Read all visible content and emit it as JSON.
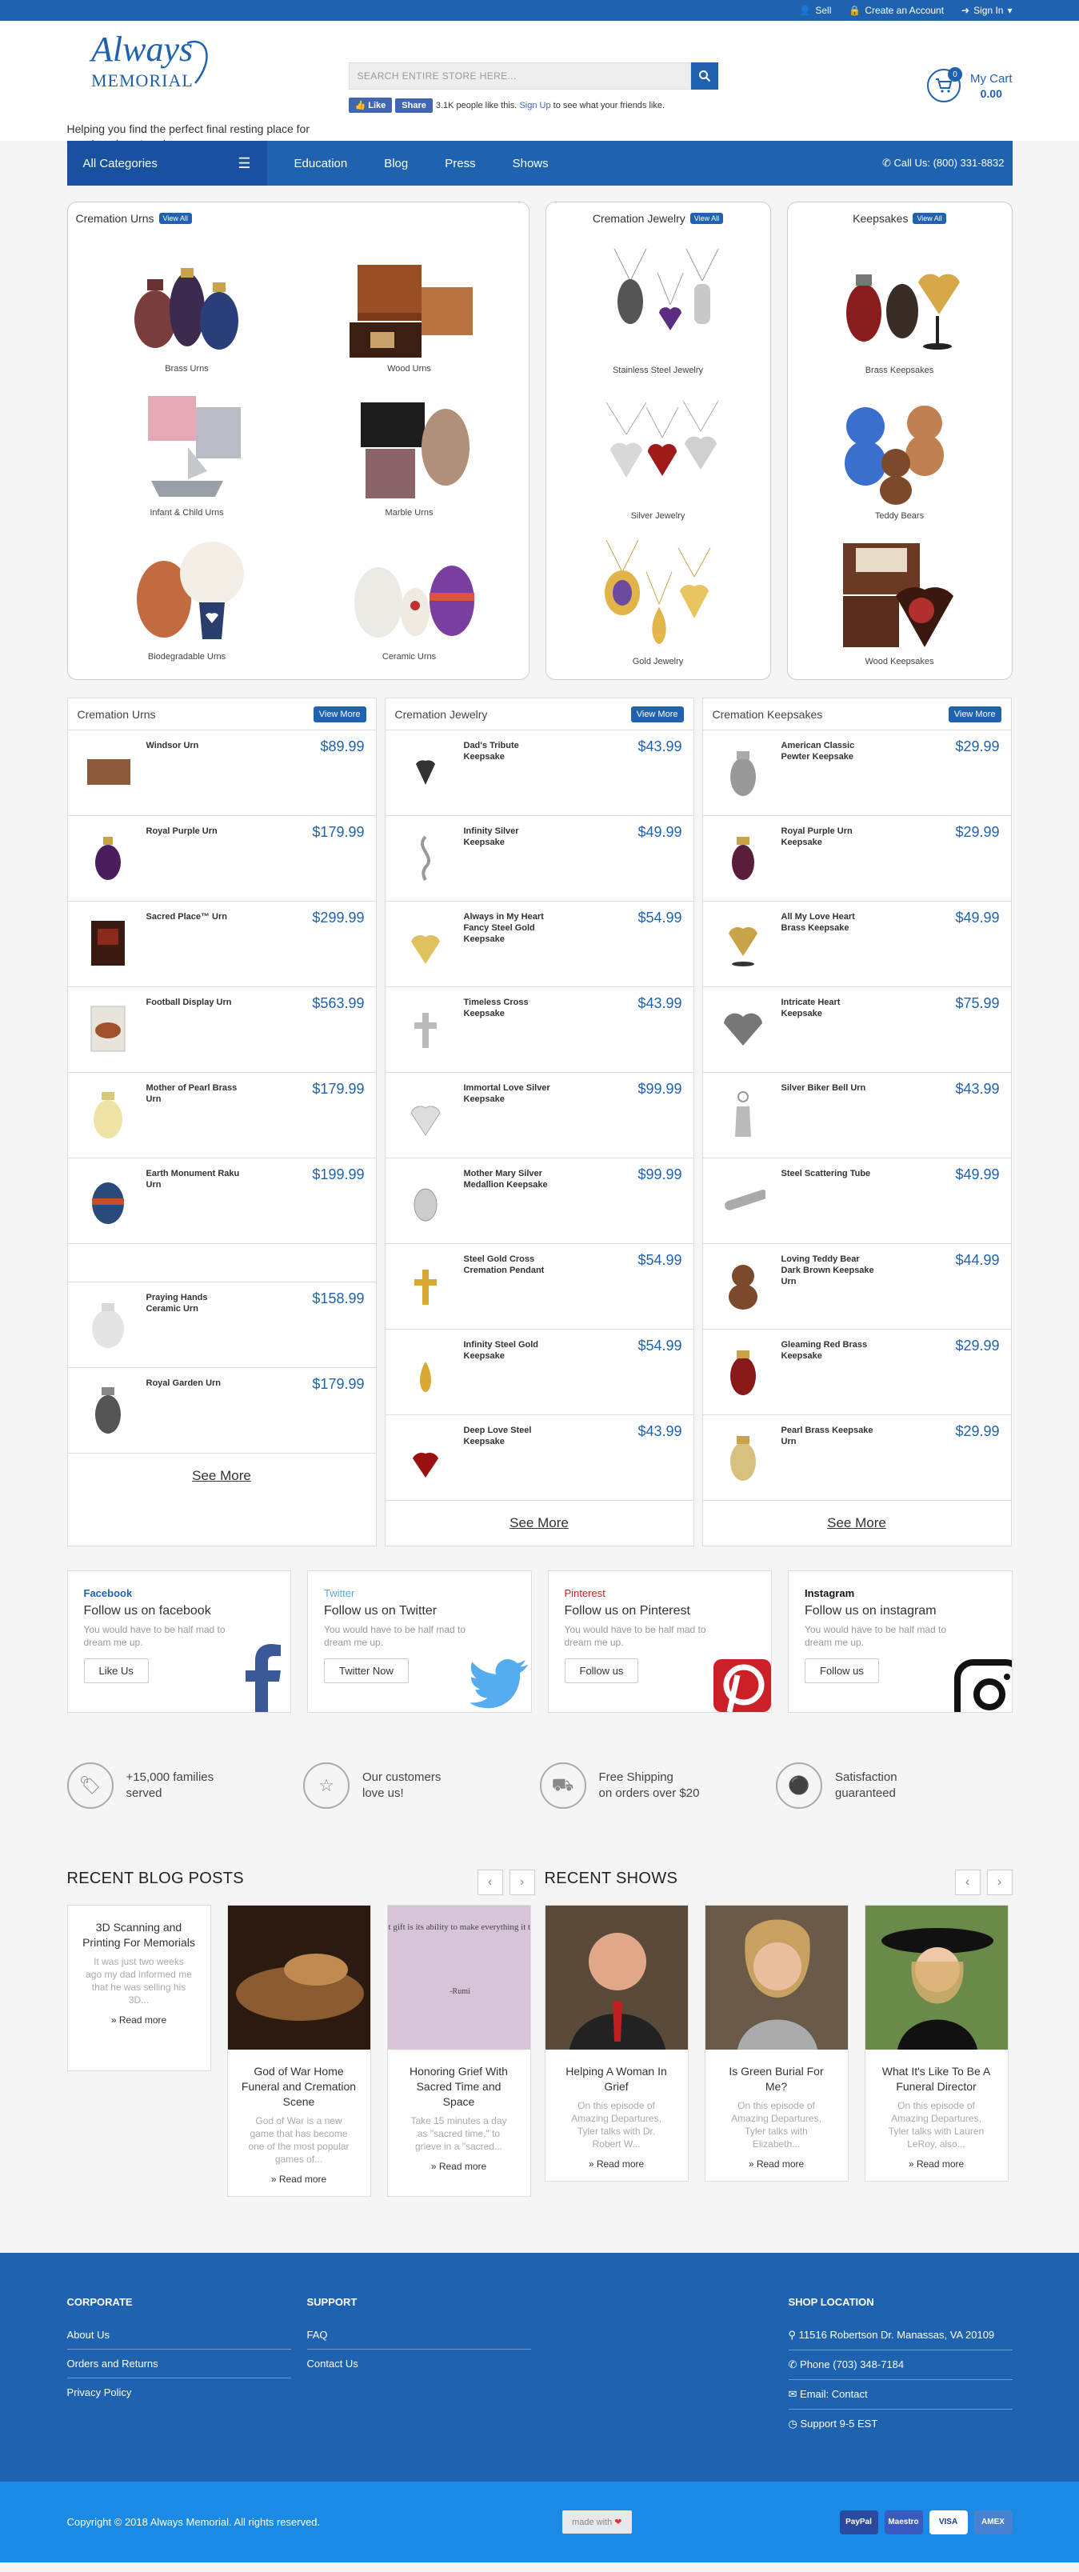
{
  "topbar": {
    "sell": "Sell",
    "create_account": "Create an Account",
    "sign_in": "Sign In"
  },
  "header": {
    "logo_line1": "Always",
    "logo_line2": "MEMORIAL",
    "tagline": "Helping you find the perfect final resting place for your loved one's ashes.",
    "search_placeholder": "SEARCH ENTIRE STORE HERE...",
    "fb_like": "Like",
    "fb_share": "Share",
    "fb_count_text": "3.1K people like this.",
    "fb_signup": "Sign Up",
    "fb_tail": "to see what your friends like.",
    "cart_label": "My Cart",
    "cart_total": "0.00",
    "cart_count": "0"
  },
  "nav": {
    "all_categories": "All Categories",
    "links": [
      "Education",
      "Blog",
      "Press",
      "Shows"
    ],
    "phone": "Call Us: (800) 331-8832"
  },
  "category_boxes": [
    {
      "title": "Cremation Urns",
      "view_all": "View All",
      "items": [
        "Brass Urns",
        "Wood Urns",
        "Infant & Child Urns",
        "Marble Urns",
        "Biodegradable Urns",
        "Ceramic Urns"
      ]
    },
    {
      "title": "Cremation Jewelry",
      "view_all": "View All",
      "items": [
        "Stainless Steel Jewelry",
        "Silver Jewelry",
        "Gold Jewelry"
      ]
    },
    {
      "title": "Keepsakes",
      "view_all": "View All",
      "items": [
        "Brass Keepsakes",
        "Teddy Bears",
        "Wood Keepsakes"
      ]
    }
  ],
  "product_columns": [
    {
      "title": "Cremation Urns",
      "view_more": "View More",
      "see_more": "See More",
      "products": [
        {
          "name": "Windsor Urn",
          "price": "$89.99"
        },
        {
          "name": "Royal Purple Urn",
          "price": "$179.99"
        },
        {
          "name": "Sacred Place™ Urn",
          "price": "$299.99"
        },
        {
          "name": "Football Display Urn",
          "price": "$563.99"
        },
        {
          "name": "Mother of Pearl Brass Urn",
          "price": "$179.99"
        },
        {
          "name": "Earth Monument Raku Urn",
          "price": "$199.99"
        },
        {
          "name": "Praying Hands Ceramic Urn",
          "price": "$158.99"
        },
        {
          "name": "Royal Garden Urn",
          "price": "$179.99"
        }
      ]
    },
    {
      "title": "Cremation Jewelry",
      "view_more": "View More",
      "see_more": "See More",
      "products": [
        {
          "name": "Dad's Tribute Keepsake",
          "price": "$43.99"
        },
        {
          "name": "Infinity Silver Keepsake",
          "price": "$49.99"
        },
        {
          "name": "Always in My Heart Fancy Steel Gold Keepsake",
          "price": "$54.99"
        },
        {
          "name": "Timeless Cross Keepsake",
          "price": "$43.99"
        },
        {
          "name": "Immortal Love Silver Keepsake",
          "price": "$99.99"
        },
        {
          "name": "Mother Mary Silver Medallion Keepsake",
          "price": "$99.99"
        },
        {
          "name": "Steel Gold Cross Cremation Pendant",
          "price": "$54.99"
        },
        {
          "name": "Infinity Steel Gold Keepsake",
          "price": "$54.99"
        },
        {
          "name": "Deep Love Steel Keepsake",
          "price": "$43.99"
        }
      ]
    },
    {
      "title": "Cremation Keepsakes",
      "view_more": "View More",
      "see_more": "See More",
      "products": [
        {
          "name": "American Classic Pewter Keepsake",
          "price": "$29.99"
        },
        {
          "name": "Royal Purple Urn Keepsake",
          "price": "$29.99"
        },
        {
          "name": "All My Love Heart Brass Keepsake",
          "price": "$49.99"
        },
        {
          "name": "Intricate Heart Keepsake",
          "price": "$75.99"
        },
        {
          "name": "Silver Biker Bell Urn",
          "price": "$43.99"
        },
        {
          "name": "Steel Scattering Tube",
          "price": "$49.99"
        },
        {
          "name": "Loving Teddy Bear Dark Brown Keepsake Urn",
          "price": "$44.99"
        },
        {
          "name": "Gleaming Red Brass Keepsake",
          "price": "$29.99"
        },
        {
          "name": "Pearl Brass Keepsake Urn",
          "price": "$29.99"
        }
      ]
    }
  ],
  "social": [
    {
      "name": "Facebook",
      "title": "Follow us on facebook",
      "desc": "You would have to be half mad to dream me up.",
      "button": "Like Us",
      "color": "#3b5998"
    },
    {
      "name": "Twitter",
      "title": "Follow us on Twitter",
      "desc": "You would have to be half mad to dream me up.",
      "button": "Twitter Now",
      "color": "#55acee"
    },
    {
      "name": "Pinterest",
      "title": "Follow us on Pinterest",
      "desc": "You would have to be half mad to dream me up.",
      "button": "Follow us",
      "color": "#cb2027"
    },
    {
      "name": "Instagram",
      "title": "Follow us on instagram",
      "desc": "You would have to be half mad to dream me up.",
      "button": "Follow us",
      "color": "#111111"
    }
  ],
  "features": [
    {
      "line1": "+15,000 families",
      "line2": "served"
    },
    {
      "line1": "Our customers",
      "line2": "love us!"
    },
    {
      "line1": "Free Shipping",
      "line2": "on orders over $20"
    },
    {
      "line1": "Satisfaction",
      "line2": "guaranteed"
    }
  ],
  "blog": {
    "heading": "RECENT BLOG POSTS",
    "posts": [
      {
        "title": "3D Scanning and Printing For Memorials",
        "excerpt": "It was just two weeks ago my dad informed me that he was selling his 3D...",
        "read_more": "» Read more"
      },
      {
        "title": "God of War Home Funeral and Cremation Scene",
        "excerpt": "God of War is a new game that has become one of the most popular games of...",
        "read_more": "» Read more"
      },
      {
        "title": "Honoring Grief With Sacred Time and Space",
        "excerpt": "Take 15 minutes a day as \"sacred time,\" to grieve in a \"sacred...",
        "read_more": "» Read more",
        "quote": "Love's greatest gift is its ability to make everything it touches sacred.",
        "quote_author": "-Rumi"
      }
    ]
  },
  "shows": {
    "heading": "RECENT SHOWS",
    "items": [
      {
        "title": "Helping A Woman In Grief",
        "excerpt": "On this episode of Amazing Departures, Tyler talks with Dr. Robert W...",
        "read_more": "» Read more"
      },
      {
        "title": "Is Green Burial For Me?",
        "excerpt": "On this episode of Amazing Departures, Tyler talks with Elizabeth...",
        "read_more": "» Read more"
      },
      {
        "title": "What It's Like To Be A Funeral Director",
        "excerpt": "On this episode of Amazing Departures, Tyler talks with Lauren LeRoy, also...",
        "read_more": "» Read more"
      }
    ]
  },
  "footer": {
    "corporate": {
      "heading": "CORPORATE",
      "links": [
        "About Us",
        "Orders and Returns",
        "Privacy Policy"
      ]
    },
    "support": {
      "heading": "SUPPORT",
      "links": [
        "FAQ",
        "Contact Us"
      ]
    },
    "location": {
      "heading": "SHOP LOCATION",
      "address": "11516 Robertson Dr. Manassas, VA 20109",
      "phone": "Phone (703) 348-7184",
      "email": "Email: Contact",
      "support": "Support 9-5 EST"
    }
  },
  "bottom": {
    "copyright": "Copyright © 2018 Always Memorial. All rights reserved.",
    "made_with": "made with",
    "payments": [
      "PayPal",
      "Maestro",
      "VISA",
      "AMEX"
    ]
  },
  "colors": {
    "primary": "#1e62b0",
    "accent": "#1a8ae5"
  }
}
